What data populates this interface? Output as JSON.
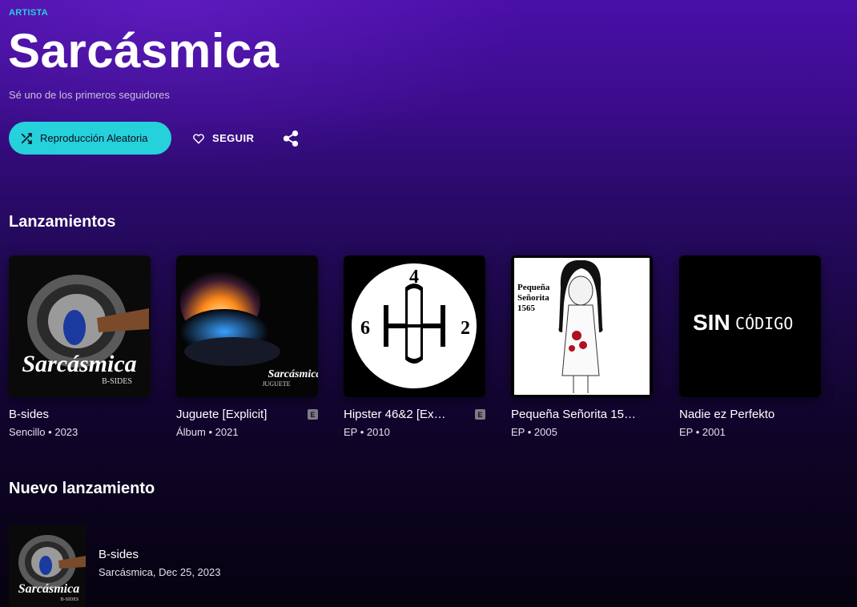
{
  "header": {
    "eyebrow": "ARTISTA",
    "artist_name": "Sarcásmica",
    "followers_text": "Sé uno de los primeros seguidores"
  },
  "actions": {
    "shuffle_label": "Reproducción Aleatoria",
    "follow_label": "SEGUIR",
    "shuffle_icon": "shuffle-icon",
    "follow_icon": "heart-icon",
    "share_icon": "share-icon"
  },
  "releases": {
    "title": "Lanzamientos",
    "items": [
      {
        "title": "B-sides",
        "type": "Sencillo",
        "year": "2023",
        "explicit": false,
        "cover_text": "Sarcásmica",
        "cover_subtext": "B-SIDES"
      },
      {
        "title": "Juguete [Explicit]",
        "type": "Álbum",
        "year": "2021",
        "explicit": true,
        "cover_text": "Sarcásmica",
        "cover_subtext": "JUGUETE"
      },
      {
        "title": "Hipster 46&2 [Ex…",
        "type": "EP",
        "year": "2010",
        "explicit": true,
        "cover_digits": [
          "4",
          "6",
          "2"
        ]
      },
      {
        "title": "Pequeña Señorita 15…",
        "type": "EP",
        "year": "2005",
        "explicit": false,
        "cover_text": "Pequeña Señorita 1565"
      },
      {
        "title": "Nadie ez Perfekto",
        "type": "EP",
        "year": "2001",
        "explicit": false,
        "cover_text": "SIN",
        "cover_subtext": "CÓDIGO"
      }
    ],
    "explicit_badge": "E",
    "separator": "•"
  },
  "new_release": {
    "title": "Nuevo lanzamiento",
    "item_title": "B-sides",
    "item_sub": "Sarcásmica, Dec 25, 2023",
    "cover_text": "Sarcásmica",
    "cover_subtext": "B-SIDES"
  },
  "colors": {
    "accent": "#25d1da",
    "background_top": "#4a0fa8",
    "background_bottom": "#06020f"
  }
}
